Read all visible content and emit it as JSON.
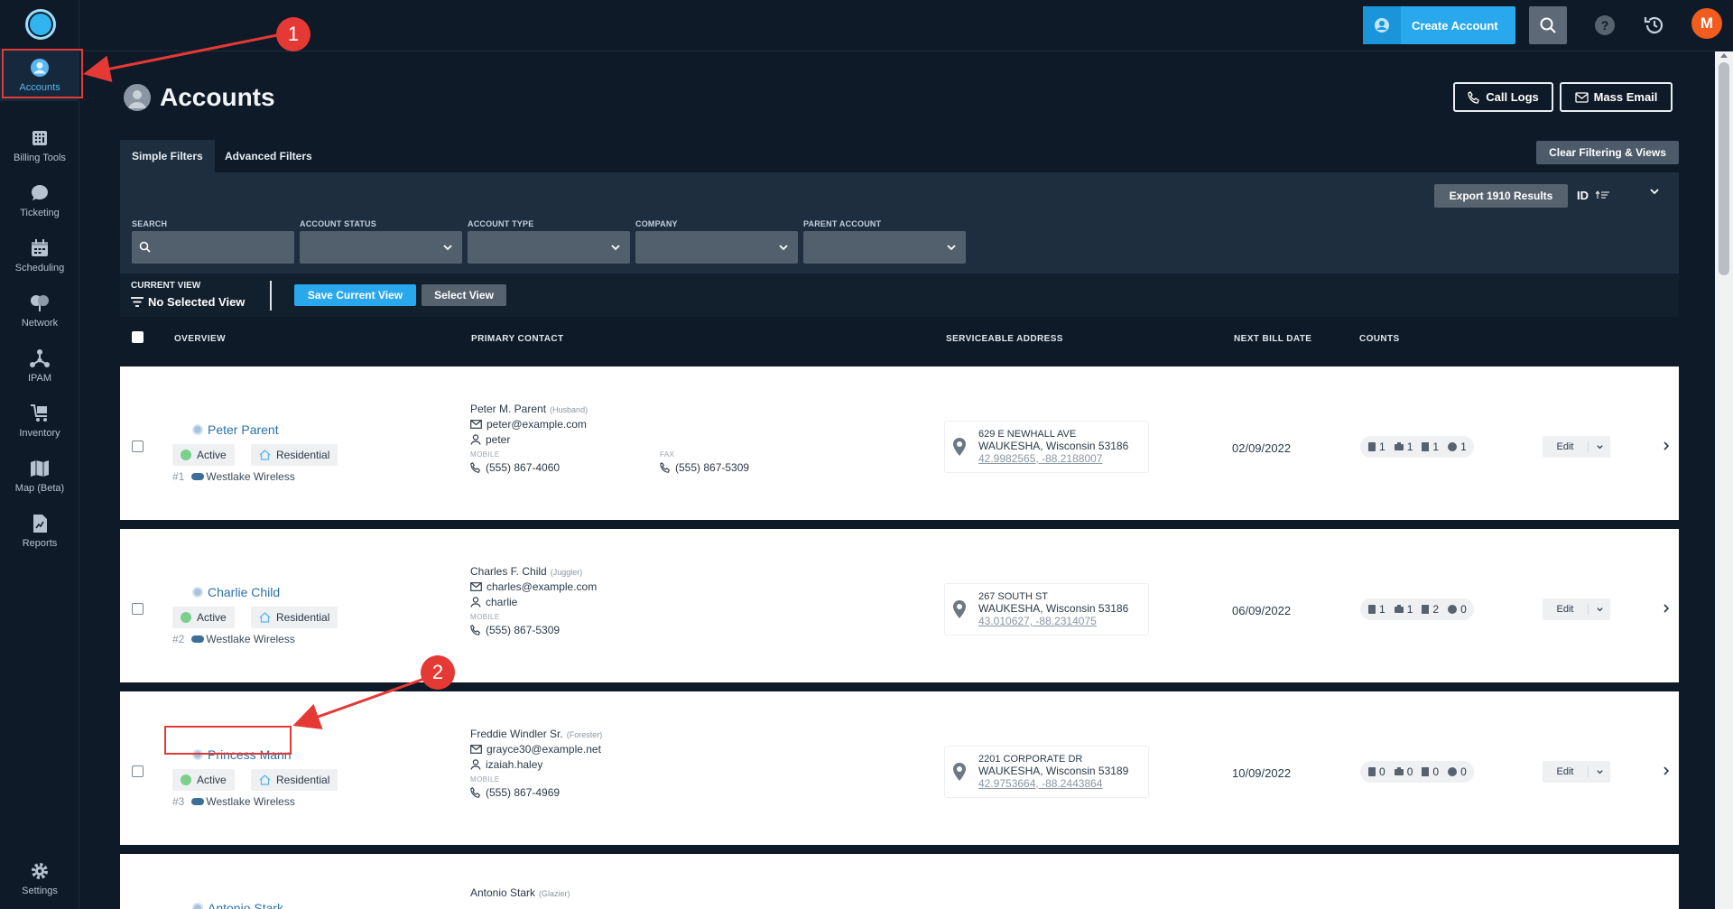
{
  "sidebar": {
    "items": [
      {
        "label": "Accounts",
        "icon": "user-circle-icon"
      },
      {
        "label": "Billing Tools",
        "icon": "calculator-icon"
      },
      {
        "label": "Ticketing",
        "icon": "chat-bubble-icon"
      },
      {
        "label": "Scheduling",
        "icon": "calendar-icon"
      },
      {
        "label": "Network",
        "icon": "network-icon"
      },
      {
        "label": "IPAM",
        "icon": "ipam-tree-icon"
      },
      {
        "label": "Inventory",
        "icon": "cart-icon"
      },
      {
        "label": "Map (Beta)",
        "icon": "map-icon"
      },
      {
        "label": "Reports",
        "icon": "report-doc-icon"
      }
    ],
    "settings_label": "Settings"
  },
  "topbar": {
    "create_label": "Create Account",
    "user_initial": "M"
  },
  "page": {
    "title": "Accounts",
    "call_logs_label": "Call Logs",
    "mass_email_label": "Mass Email"
  },
  "filters": {
    "tabs": [
      "Simple Filters",
      "Advanced Filters"
    ],
    "clear_label": "Clear Filtering & Views",
    "export_label": "Export 1910 Results",
    "sort_label": "ID",
    "fields": [
      {
        "label": "SEARCH",
        "value": ""
      },
      {
        "label": "ACCOUNT STATUS",
        "value": ""
      },
      {
        "label": "ACCOUNT TYPE",
        "value": ""
      },
      {
        "label": "COMPANY",
        "value": ""
      },
      {
        "label": "PARENT ACCOUNT",
        "value": ""
      }
    ]
  },
  "view": {
    "current_label": "CURRENT VIEW",
    "current_value": "No Selected View",
    "save_label": "Save Current View",
    "select_label": "Select View"
  },
  "table": {
    "columns": [
      "OVERVIEW",
      "PRIMARY CONTACT",
      "SERVICEABLE ADDRESS",
      "NEXT BILL DATE",
      "COUNTS"
    ],
    "rows": [
      {
        "name": "Peter Parent",
        "status": "Active",
        "type": "Residential",
        "id": "#1",
        "company": "Westlake Wireless",
        "contact_name": "Peter M. Parent",
        "contact_role": "(Husband)",
        "email": "peter@example.com",
        "username": "peter",
        "mobile_label": "MOBILE",
        "mobile": "(555) 867-4060",
        "fax_label": "FAX",
        "fax": "(555) 867-5309",
        "addr1": "629 E NEWHALL AVE",
        "addr2": "WAUKESHA, Wisconsin 53186",
        "coords": "42.9982565, -88.2188007",
        "bill_date": "02/09/2022",
        "counts": [
          "1",
          "1",
          "1",
          "1"
        ],
        "edit_label": "Edit"
      },
      {
        "name": "Charlie Child",
        "status": "Active",
        "type": "Residential",
        "id": "#2",
        "company": "Westlake Wireless",
        "contact_name": "Charles F. Child",
        "contact_role": "(Juggler)",
        "email": "charles@example.com",
        "username": "charlie",
        "mobile_label": "MOBILE",
        "mobile": "(555) 867-5309",
        "fax_label": "",
        "fax": "",
        "addr1": "267 SOUTH ST",
        "addr2": "WAUKESHA, Wisconsin 53186",
        "coords": "43.010627, -88.2314075",
        "bill_date": "06/09/2022",
        "counts": [
          "1",
          "1",
          "2",
          "0"
        ],
        "edit_label": "Edit"
      },
      {
        "name": "Princess Mann",
        "status": "Active",
        "type": "Residential",
        "id": "#3",
        "company": "Westlake Wireless",
        "contact_name": "Freddie Windler Sr.",
        "contact_role": "(Forester)",
        "email": "grayce30@example.net",
        "username": "izaiah.haley",
        "mobile_label": "MOBILE",
        "mobile": "(555) 867-4969",
        "fax_label": "",
        "fax": "",
        "addr1": "2201 CORPORATE DR",
        "addr2": "WAUKESHA, Wisconsin 53189",
        "coords": "42.9753664, -88.2443864",
        "bill_date": "10/09/2022",
        "counts": [
          "0",
          "0",
          "0",
          "0"
        ],
        "edit_label": "Edit"
      },
      {
        "name": "Antonio Stark",
        "contact_name": "Antonio Stark",
        "contact_role": "(Glazier)"
      }
    ]
  },
  "annotations": [
    "1",
    "2"
  ],
  "colors": {
    "accent": "#2aa8ee",
    "annotation": "#e53935",
    "background": "#0e1a27",
    "panel": "#1e2e3f"
  }
}
